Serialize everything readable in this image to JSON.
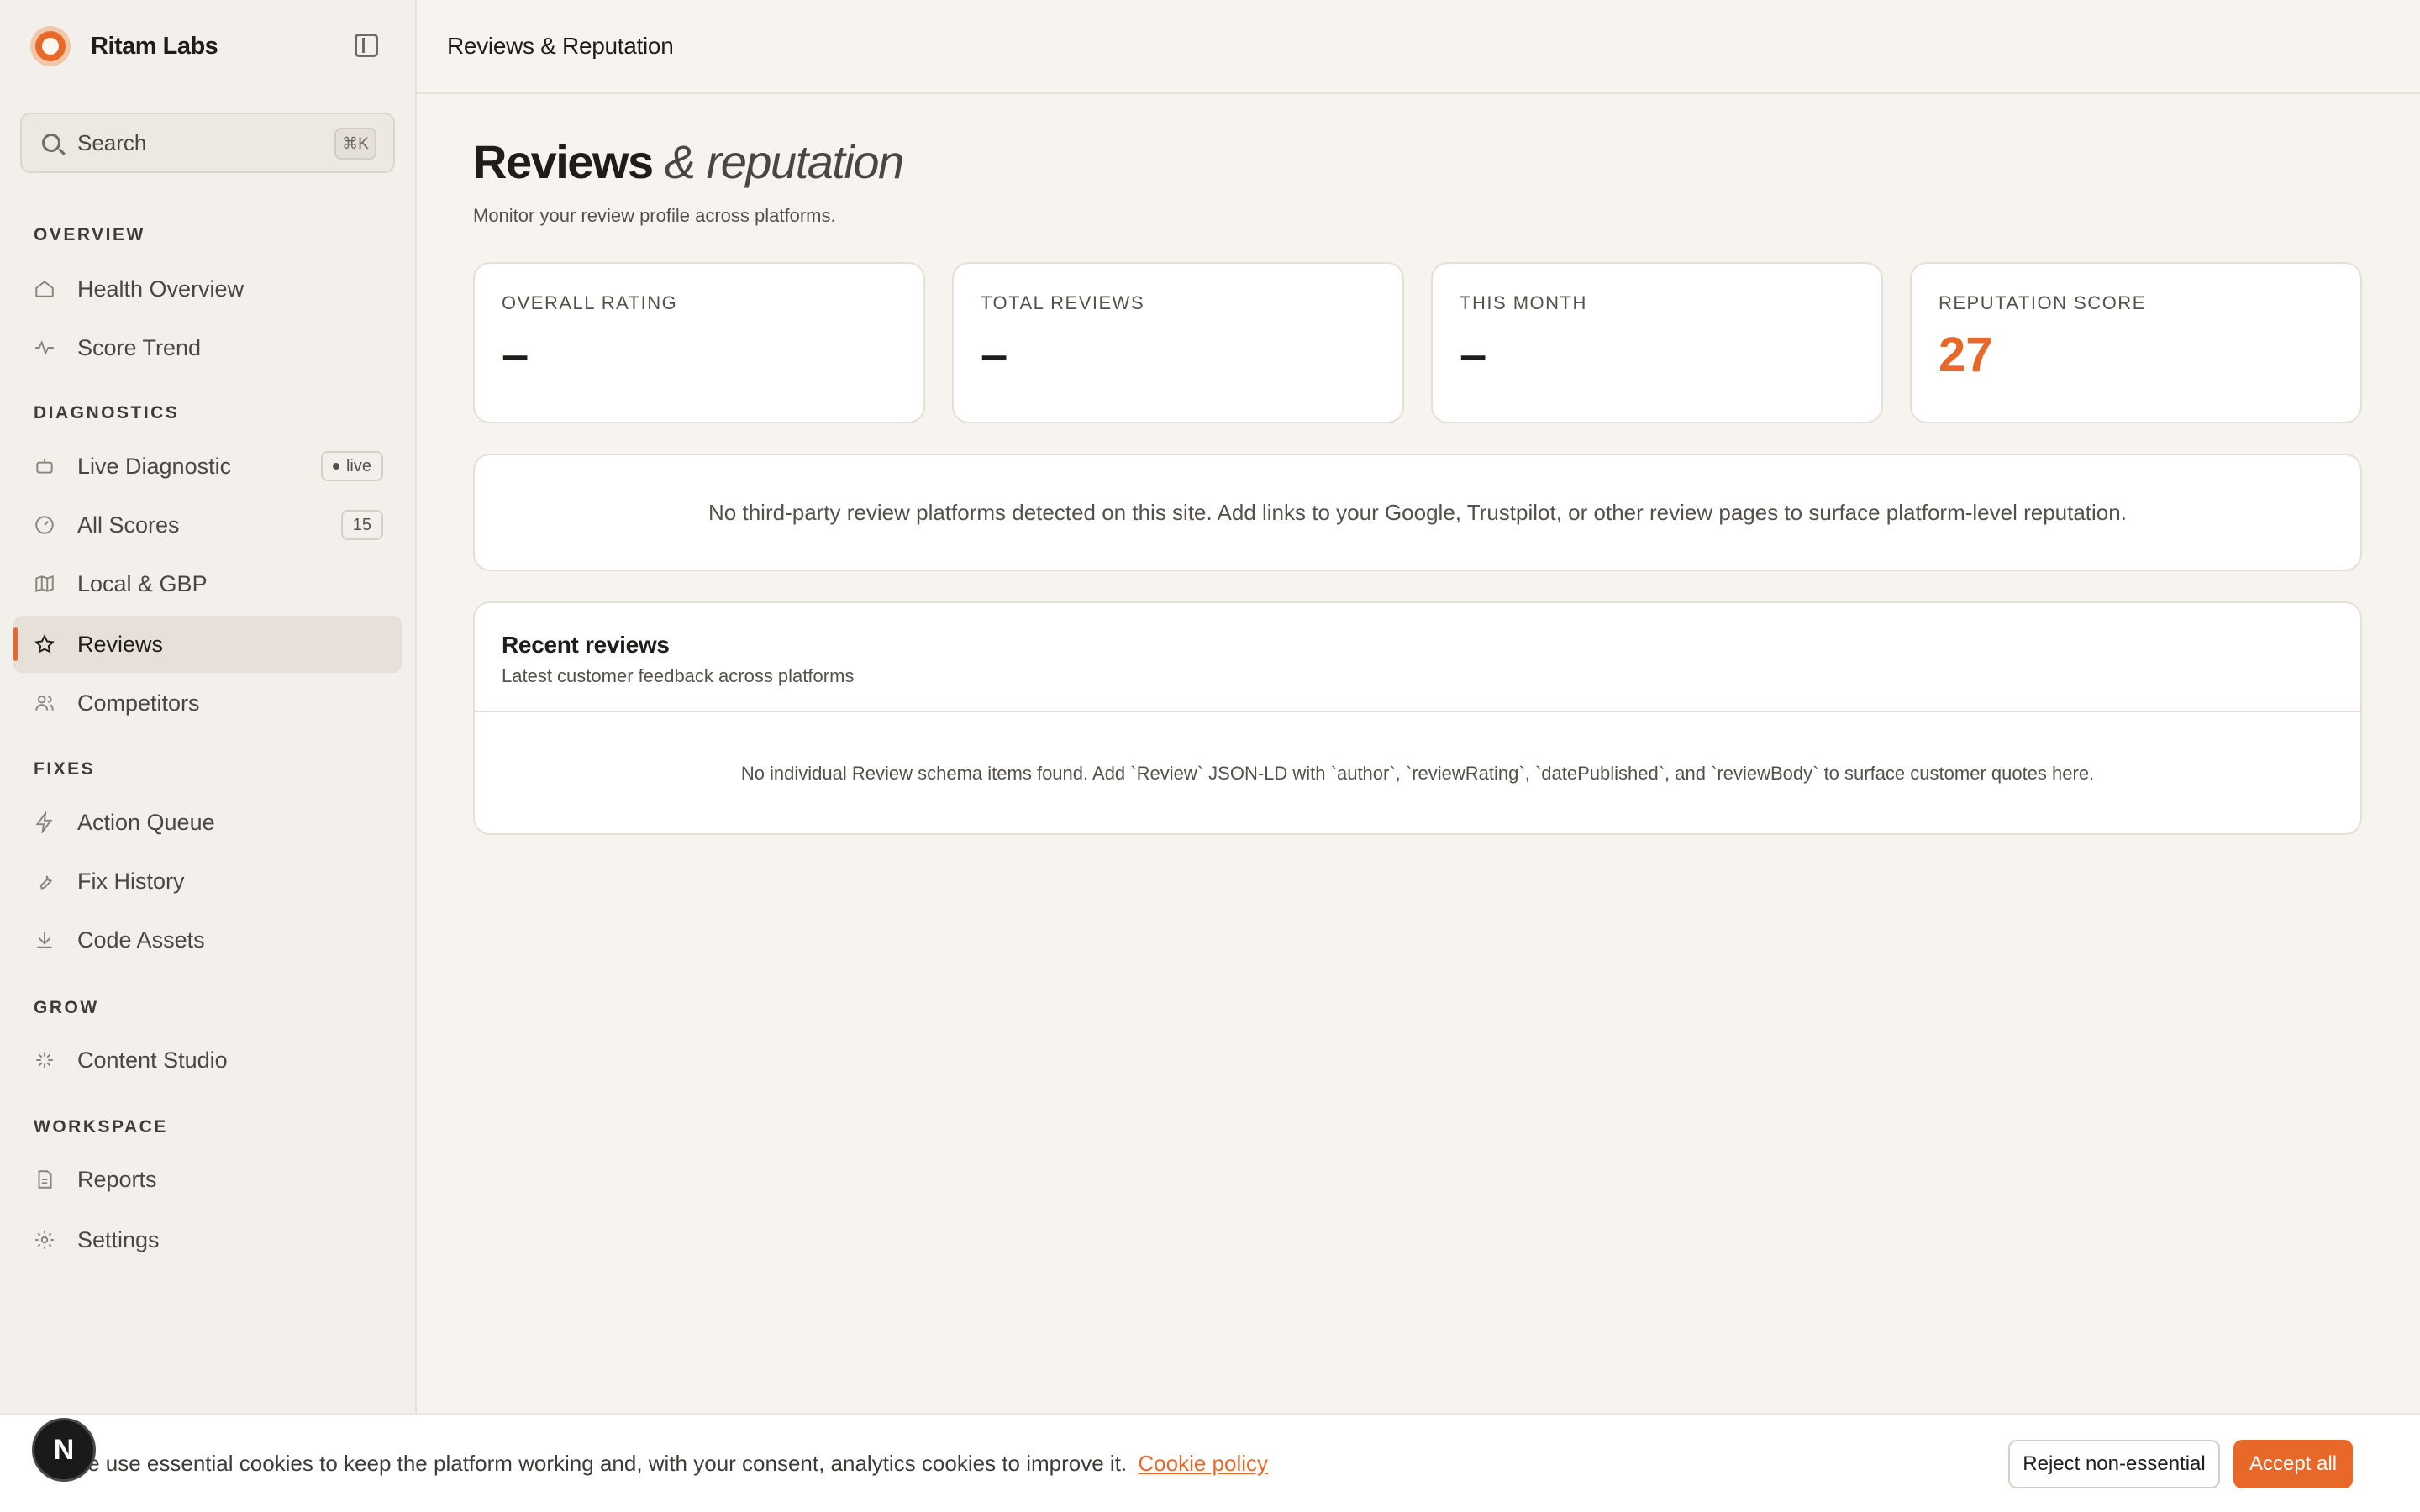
{
  "brand": {
    "name": "Ritam Labs"
  },
  "search": {
    "label": "Search",
    "shortcut": "⌘K"
  },
  "sidebar": {
    "sections": {
      "overview": "OVERVIEW",
      "diagnostics": "DIAGNOSTICS",
      "fixes": "FIXES",
      "grow": "GROW",
      "workspace": "WORKSPACE"
    },
    "items": {
      "health_overview": "Health Overview",
      "score_trend": "Score Trend",
      "live_diagnostic": "Live Diagnostic",
      "live_badge": "live",
      "all_scores": "All Scores",
      "all_scores_count": "15",
      "local_gbp": "Local & GBP",
      "reviews": "Reviews",
      "competitors": "Competitors",
      "action_queue": "Action Queue",
      "fix_history": "Fix History",
      "code_assets": "Code Assets",
      "content_studio": "Content Studio",
      "reports": "Reports",
      "settings": "Settings"
    }
  },
  "header": {
    "title": "Reviews & Reputation"
  },
  "page": {
    "title_main": "Reviews",
    "title_em": "& reputation",
    "subtitle": "Monitor your review profile across platforms."
  },
  "stats": [
    {
      "label": "OVERALL RATING",
      "value": "–"
    },
    {
      "label": "TOTAL REVIEWS",
      "value": "–"
    },
    {
      "label": "THIS MONTH",
      "value": "–"
    },
    {
      "label": "REPUTATION SCORE",
      "value": "27"
    }
  ],
  "notice": "No third-party review platforms detected on this site. Add links to your Google, Trustpilot, or other review pages to surface platform-level reputation.",
  "recent": {
    "title": "Recent reviews",
    "subtitle": "Latest customer feedback across platforms",
    "empty": "No individual Review schema items found. Add `Review` JSON-LD with `author`, `reviewRating`, `datePublished`, and `reviewBody` to surface customer quotes here."
  },
  "cookie": {
    "text": "We use essential cookies to keep the platform working and, with your consent, analytics cookies to improve it.",
    "link": "Cookie policy",
    "reject": "Reject non-essential",
    "accept": "Accept all"
  },
  "avatar": {
    "letter": "N"
  },
  "colors": {
    "accent": "#e8682a",
    "background": "#f7f4ef",
    "sidebar": "#f3f0eb"
  }
}
